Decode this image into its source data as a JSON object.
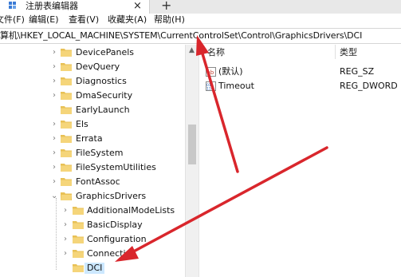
{
  "window": {
    "tab_title": "注册表编辑器",
    "tab_close": "×",
    "new_tab": "+"
  },
  "menu": {
    "items": [
      "文件(F)",
      "编辑(E)",
      "查看(V)",
      "收藏夹(A)",
      "帮助(H)"
    ]
  },
  "address": {
    "path": "算机\\HKEY_LOCAL_MACHINE\\SYSTEM\\CurrentControlSet\\Control\\GraphicsDrivers\\DCI"
  },
  "tree": {
    "items": [
      {
        "label": "DevicePanels",
        "expander": "›"
      },
      {
        "label": "DevQuery",
        "expander": "›"
      },
      {
        "label": "Diagnostics",
        "expander": "›"
      },
      {
        "label": "DmaSecurity",
        "expander": "›"
      },
      {
        "label": "EarlyLaunch",
        "expander": ""
      },
      {
        "label": "Els",
        "expander": "›"
      },
      {
        "label": "Errata",
        "expander": "›"
      },
      {
        "label": "FileSystem",
        "expander": "›"
      },
      {
        "label": "FileSystemUtilities",
        "expander": "›"
      },
      {
        "label": "FontAssoc",
        "expander": "›"
      },
      {
        "label": "GraphicsDrivers",
        "expander": "⌄"
      },
      {
        "label": "AdditionalModeLists",
        "expander": "›"
      },
      {
        "label": "BasicDisplay",
        "expander": "›"
      },
      {
        "label": "Configuration",
        "expander": "›"
      },
      {
        "label": "Connecti",
        "expander": "›"
      },
      {
        "label": "DCI",
        "expander": ""
      }
    ],
    "selected": "DCI"
  },
  "values": {
    "columns": {
      "name": "名称",
      "type": "类型"
    },
    "rows": [
      {
        "name": "(默认)",
        "type": "REG_SZ",
        "icon": "string-value-icon"
      },
      {
        "name": "Timeout",
        "type": "REG_DWORD",
        "icon": "dword-value-icon"
      }
    ]
  },
  "colors": {
    "folder": "#e8c156",
    "selection": "#cce8ff",
    "arrow": "#d9262c"
  }
}
